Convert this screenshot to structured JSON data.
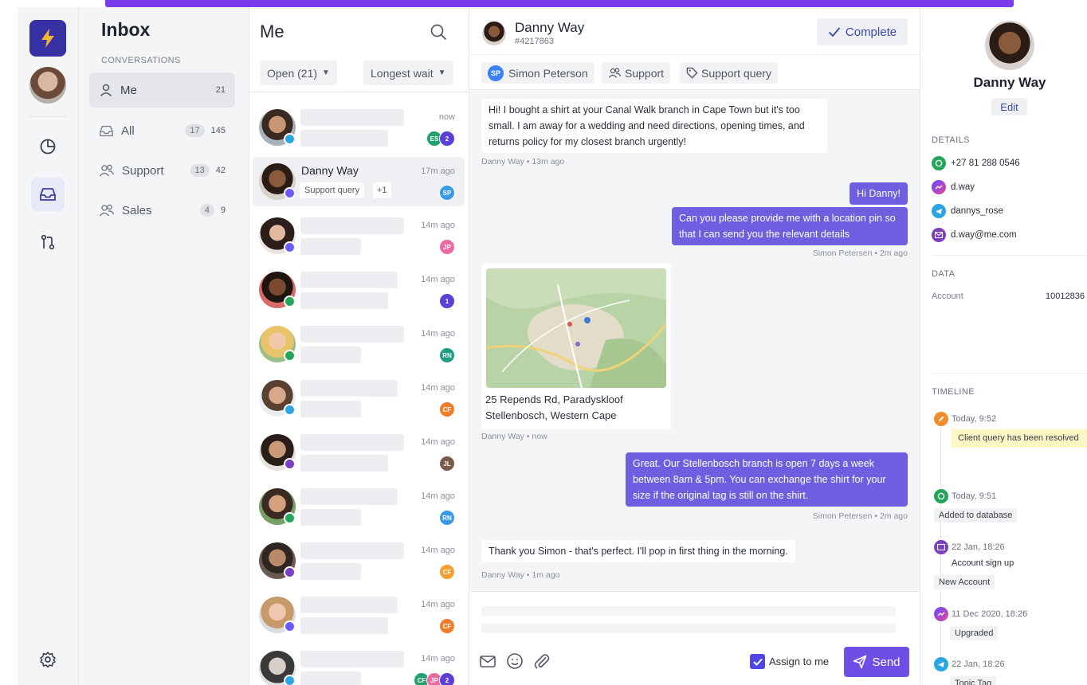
{
  "sidebar": {
    "title": "Inbox",
    "section": "CONVERSATIONS",
    "items": [
      {
        "label": "Me",
        "count": "21"
      },
      {
        "label": "All",
        "pill": "17",
        "count": "145"
      },
      {
        "label": "Support",
        "pill": "13",
        "count": "42"
      },
      {
        "label": "Sales",
        "pill": "4",
        "count": "9"
      }
    ]
  },
  "list": {
    "title": "Me",
    "filter_status": "Open (21)",
    "filter_sort": "Longest wait",
    "conversations": [
      {
        "time": "now",
        "channel": "telegram",
        "badges": [
          {
            "text": "ES",
            "color": "#22a06b"
          },
          {
            "text": "2",
            "color": "#5b3fd6"
          }
        ]
      },
      {
        "name": "Danny Way",
        "tag": "Support query",
        "extra": "+1",
        "time": "17m ago",
        "channel": "messenger",
        "badges": [
          {
            "text": "SP",
            "color": "#3b9ae8"
          }
        ]
      },
      {
        "time": "14m ago",
        "channel": "messenger",
        "badges": [
          {
            "text": "JP",
            "color": "#ec6aa4"
          }
        ]
      },
      {
        "time": "14m ago",
        "channel": "whatsapp",
        "badges": [
          {
            "text": "1",
            "color": "#5b3fd6"
          }
        ]
      },
      {
        "time": "14m ago",
        "channel": "whatsapp",
        "badges": [
          {
            "text": "RN",
            "color": "#1f9e84"
          }
        ]
      },
      {
        "time": "14m ago",
        "channel": "telegram",
        "badges": [
          {
            "text": "CF",
            "color": "#f07b2a"
          }
        ]
      },
      {
        "time": "14m ago",
        "channel": "email",
        "badges": [
          {
            "text": "JL",
            "color": "#7a5a4a"
          }
        ]
      },
      {
        "time": "14m ago",
        "channel": "whatsapp",
        "badges": [
          {
            "text": "RN",
            "color": "#3b9ae8"
          }
        ]
      },
      {
        "time": "14m ago",
        "channel": "email",
        "badges": [
          {
            "text": "CF",
            "color": "#f5a030"
          }
        ]
      },
      {
        "time": "14m ago",
        "channel": "messenger",
        "badges": [
          {
            "text": "CF",
            "color": "#f07b2a"
          }
        ]
      },
      {
        "time": "14m ago",
        "channel": "telegram",
        "badges": [
          {
            "text": "CF",
            "color": "#22a06b"
          },
          {
            "text": "JP",
            "color": "#ec6aa4"
          },
          {
            "text": "2",
            "color": "#5b3fd6"
          }
        ]
      }
    ]
  },
  "chat": {
    "contact_name": "Danny Way",
    "contact_id": "#4217863",
    "complete_label": "Complete",
    "chips": [
      "Simon Peterson",
      "Support",
      "Support query"
    ],
    "assignee_initials": "SP",
    "messages": [
      {
        "text": "Hi! I bought a shirt at your Canal Walk branch in Cape Town but it's too small. I am away for a wedding and need directions, opening times, and returns policy for my closest branch urgently!",
        "meta": "Danny Way • 13m ago"
      },
      {
        "text": "Hi Danny!"
      },
      {
        "text": "Can you please provide me with a location pin so that I can send you the relevant details",
        "meta": "Simon Petersen • 2m ago"
      },
      {
        "address_line1": "25 Repends Rd, Paradyskloof",
        "address_line2": "Stellenbosch, Western Cape",
        "meta": "Danny Way • now"
      },
      {
        "text": "Great. Our Stellenbosch branch is open 7 days a week between 8am & 5pm. You can exchange the shirt for your size if the original tag is still on the shirt.",
        "meta": "Simon Petersen • 2m ago"
      },
      {
        "text": "Thank you Simon - that's perfect. I'll pop in first thing in the morning.",
        "meta": "Danny Way • 1m ago"
      }
    ],
    "assign_label": "Assign to me",
    "send_label": "Send"
  },
  "details": {
    "name": "Danny Way",
    "edit_label": "Edit",
    "details_heading": "DETAILS",
    "phone": "+27 81 288 0546",
    "messenger": "d.way",
    "telegram": "dannys_rose",
    "email": "d.way@me.com",
    "data_heading": "DATA",
    "account_label": "Account",
    "account_value": "10012836",
    "timeline_heading": "TIMELINE",
    "timeline": [
      {
        "time": "Today, 9:52",
        "note": "Client query has been resolved"
      },
      {
        "time": "Today, 9:51",
        "tag": "Added to database"
      },
      {
        "time": "22 Jan, 18:26",
        "title": "Account sign up",
        "tag": "New Account"
      },
      {
        "time": "11 Dec 2020, 18:26",
        "tag": "Upgraded"
      },
      {
        "time": "22 Jan, 18:26",
        "tag": "Topic Tag"
      }
    ]
  },
  "colors": {
    "accent": "#6d5fe0",
    "brand": "#3730a3",
    "topbar": "#7c3aed"
  }
}
